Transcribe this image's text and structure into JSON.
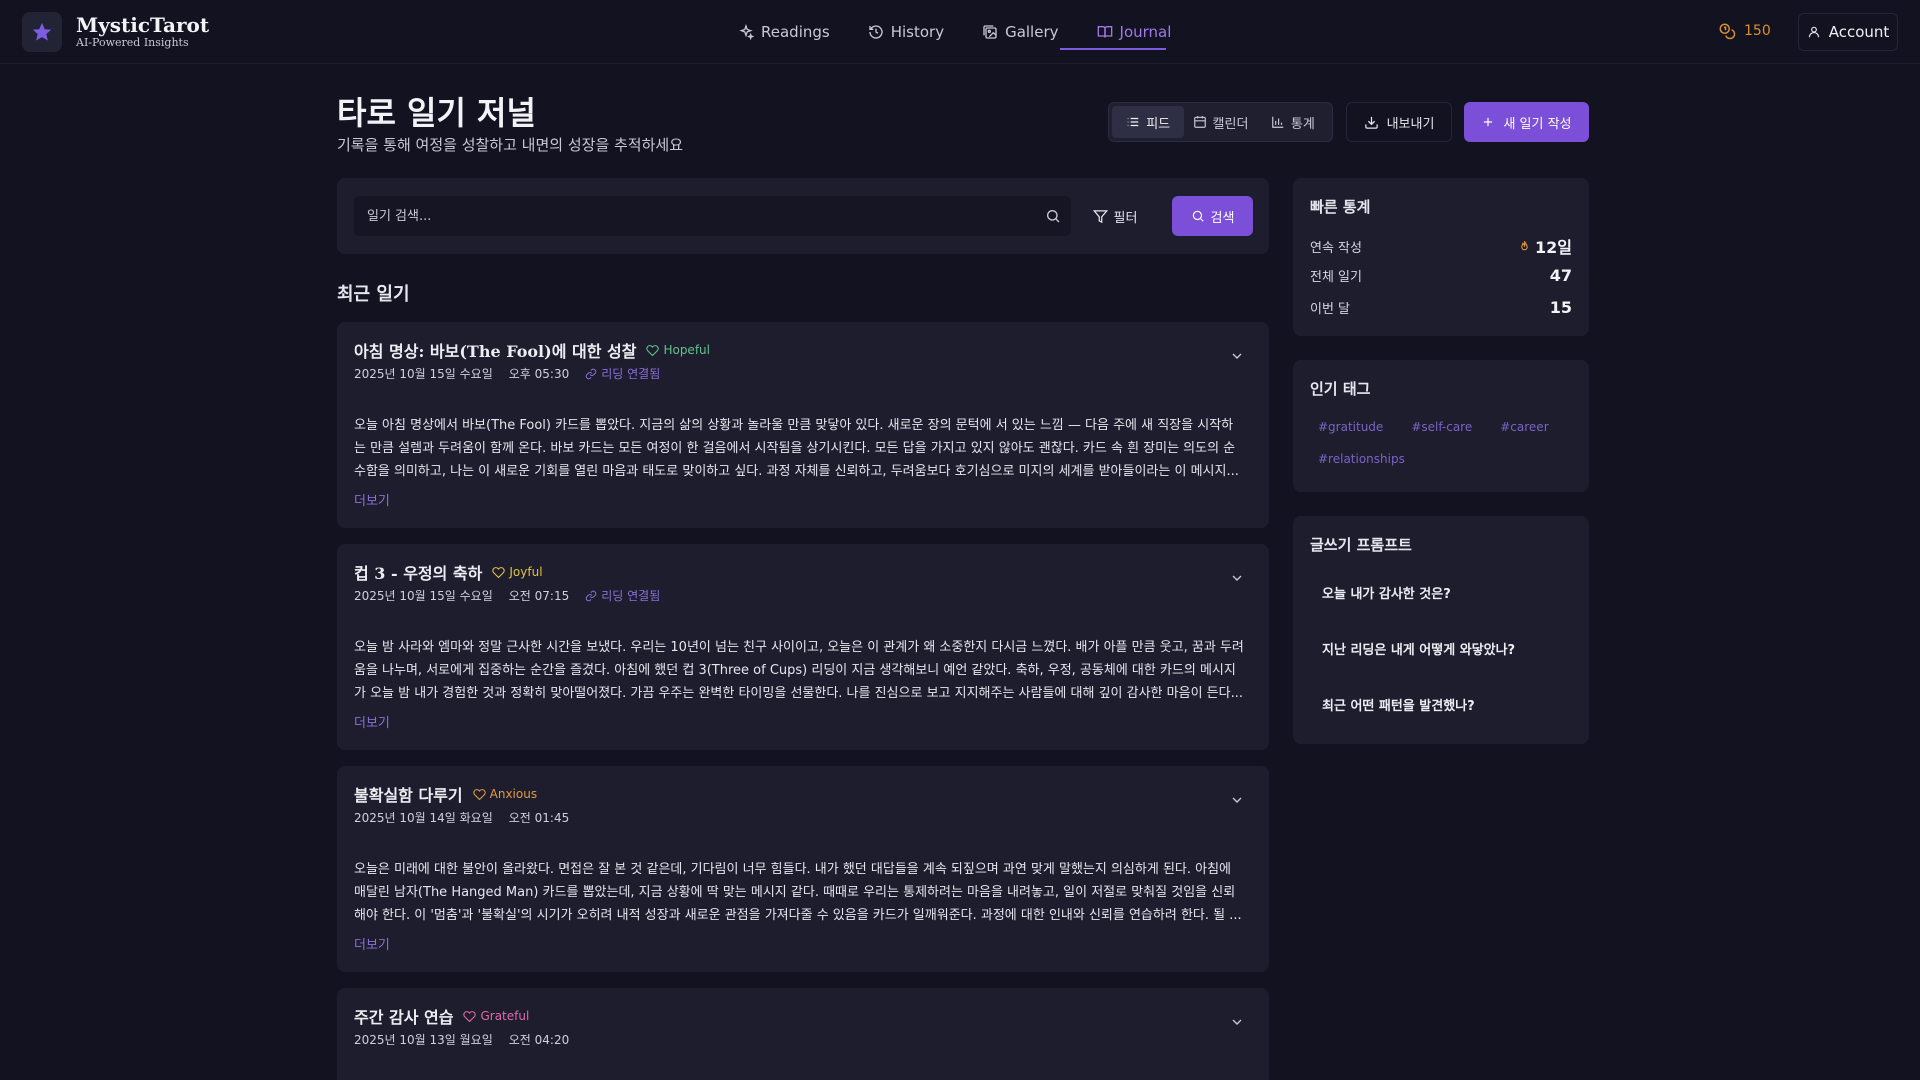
{
  "brand": {
    "name": "MysticTarot",
    "tagline": "AI-Powered Insights"
  },
  "nav": {
    "items": [
      {
        "label": "Readings",
        "icon": "sparkles-icon"
      },
      {
        "label": "History",
        "icon": "history-icon"
      },
      {
        "label": "Gallery",
        "icon": "gallery-icon"
      },
      {
        "label": "Journal",
        "icon": "book-icon",
        "active": true
      }
    ],
    "coins": "150",
    "account_label": "Account"
  },
  "header": {
    "title": "타로 일기 저널",
    "subtitle": "기록을 통해 여정을 성찰하고 내면의 성장을 추적하세요"
  },
  "view_toggle": [
    {
      "label": "피드",
      "icon": "list-icon",
      "active": true
    },
    {
      "label": "캘린더",
      "icon": "calendar-icon"
    },
    {
      "label": "통계",
      "icon": "bar-chart-icon"
    }
  ],
  "actions": {
    "export_label": "내보내기",
    "new_entry_label": "새 일기 작성"
  },
  "search": {
    "placeholder": "일기 검색...",
    "filter_label": "필터",
    "search_label": "검색"
  },
  "recent_title": "최근 일기",
  "entries": [
    {
      "title": "아침 명상: 바보(The Fool)에 대한 성찰",
      "mood": "Hopeful",
      "date": "2025년 10월 15일 수요일",
      "time": "오후 05:30",
      "linked": "리딩 연결됨",
      "body": [
        "오늘 아침 명상에서 바보(The Fool) 카드를 뽑았다. 지금의 삶의 상황과 놀라울 만큼 맞닿아 있다. 새로운 장의 문턱에 서 있는 느낌 — 다음 주에 새 직장을 시작하",
        "는 만큼 설렘과 두려움이 함께 온다. 바보 카드는 모든 여정이 한 걸음에서 시작됨을 상기시킨다. 모든 답을 가지고 있지 않아도 괜찮다. 카드 속 흰 장미는 의도의 순",
        "수함을 의미하고, 나는 이 새로운 기회를 열린 마음과 태도로 맞이하고 싶다. 과정 자체를 신뢰하고, 두려움보다 호기심으로 미지의 세계를 받아들이라는 이 메시지..."
      ],
      "more": "더보기"
    },
    {
      "title": "컵 3 - 우정의 축하",
      "mood": "Joyful",
      "date": "2025년 10월 15일 수요일",
      "time": "오전 07:15",
      "linked": "리딩 연결됨",
      "body": [
        "오늘 밤 사라와 엠마와 정말 근사한 시간을 보냈다. 우리는 10년이 넘는 친구 사이이고, 오늘은 이 관계가 왜 소중한지 다시금 느꼈다. 배가 아플 만큼 웃고, 꿈과 두려",
        "움을 나누며, 서로에게 집중하는 순간을 즐겼다. 아침에 했던 컵 3(Three of Cups) 리딩이 지금 생각해보니 예언 같았다. 축하, 우정, 공동체에 대한 카드의 메시지",
        "가 오늘 밤 내가 경험한 것과 정확히 맞아떨어졌다. 가끔 우주는 완벽한 타이밍을 선물한다. 나를 진심으로 보고 지지해주는 사람들에 대해 깊이 감사한 마음이 든다..."
      ],
      "more": "더보기"
    },
    {
      "title": "불확실함 다루기",
      "mood": "Anxious",
      "date": "2025년 10월 14일 화요일",
      "time": "오전 01:45",
      "linked": "",
      "body": [
        "오늘은 미래에 대한 불안이 올라왔다. 면접은 잘 본 것 같은데, 기다림이 너무 힘들다. 내가 했던 대답들을 계속 되짚으며 과연 맞게 말했는지 의심하게 된다. 아침에",
        "매달린 남자(The Hanged Man) 카드를 뽑았는데, 지금 상황에 딱 맞는 메시지 같다. 때때로 우리는 통제하려는 마음을 내려놓고, 일이 저절로 맞춰질 것임을 신뢰",
        "해야 한다. 이 '멈춤'과 '불확실'의 시기가 오히려 내적 성장과 새로운 관점을 가져다줄 수 있음을 카드가 일깨워준다. 과정에 대한 인내와 신뢰를 연습하려 한다. 될 ..."
      ],
      "more": "더보기"
    },
    {
      "title": "주간 감사 연습",
      "mood": "Grateful",
      "date": "2025년 10월 13일 월요일",
      "time": "오전 04:20",
      "linked": "",
      "body": [],
      "more": ""
    }
  ],
  "quick_stats": {
    "title": "빠른 통계",
    "rows": [
      {
        "label": "연속 작성",
        "value": "12일"
      },
      {
        "label": "전체 일기",
        "value": "47"
      },
      {
        "label": "이번 달",
        "value": "15"
      }
    ]
  },
  "popular_tags": {
    "title": "인기 태그",
    "tags": [
      "#gratitude",
      "#self-care",
      "#career",
      "#relationships"
    ]
  },
  "writing_prompts": {
    "title": "글쓰기 프롬프트",
    "items": [
      "오늘 내가 감사한 것은?",
      "지난 리딩은 내게 어떻게 와닿았나?",
      "최근 어떤 패턴을 발견했나?"
    ]
  },
  "colors": {
    "accent": "#7c4fd8",
    "background": "#121220",
    "card": "#1d1d2e",
    "mood_hopeful": "#5fc48a",
    "mood_joyful": "#e3c23e",
    "mood_anxious": "#e59a3a",
    "mood_grateful": "#e06aa8"
  }
}
